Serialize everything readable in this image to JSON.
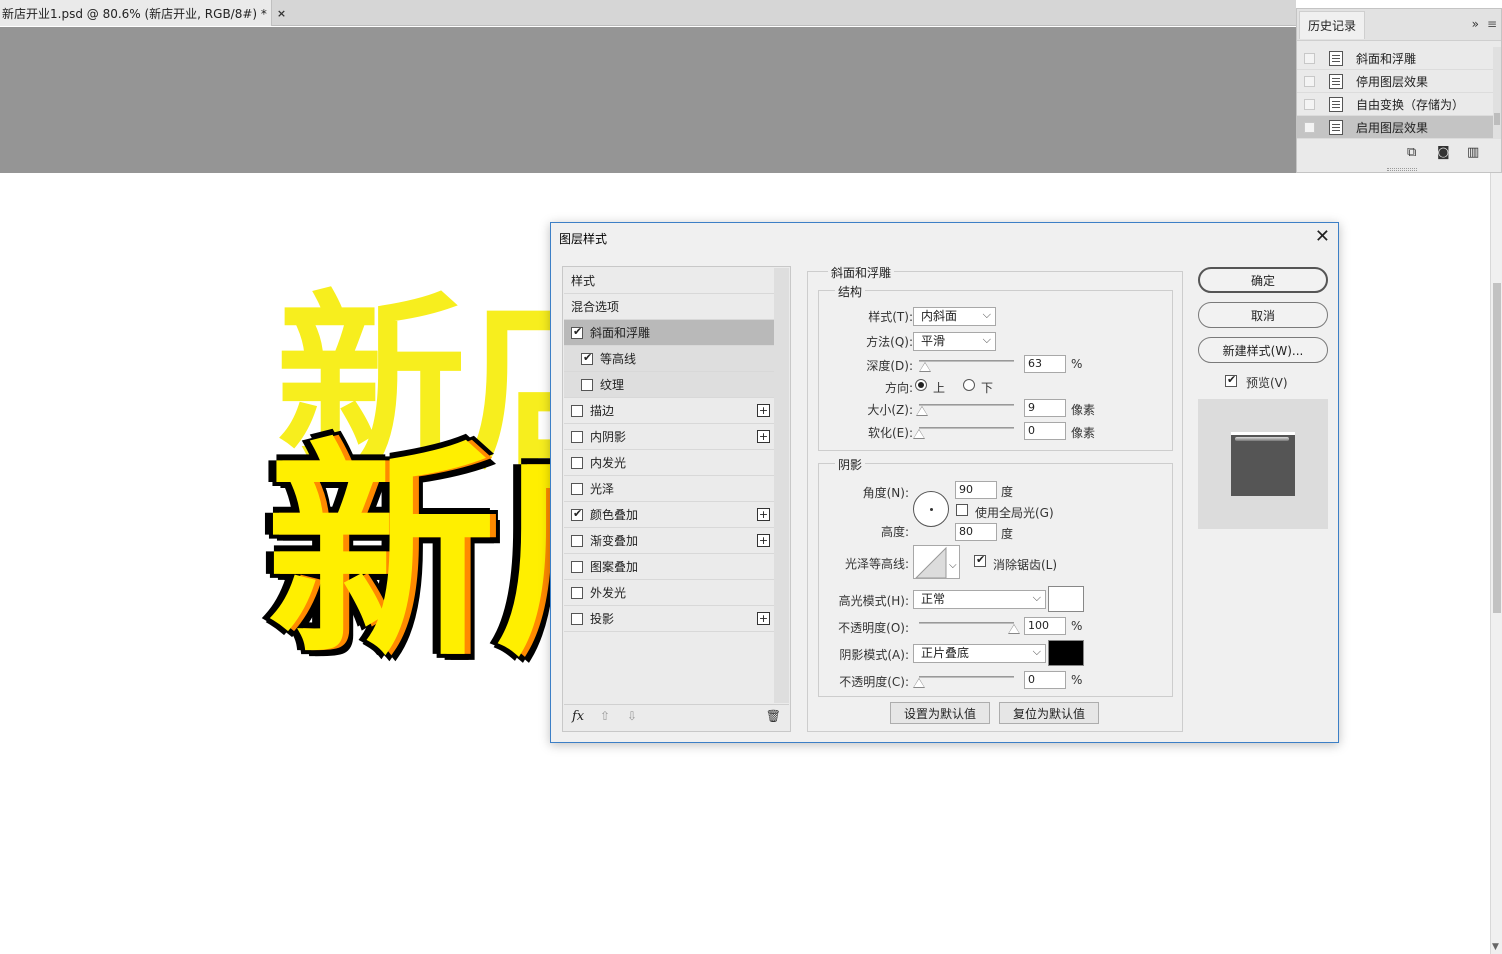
{
  "document": {
    "tab_title": "新店开业1.psd @ 80.6% (新店开业, RGB/8#) *",
    "close_glyph": "×",
    "art_text_back": "新店",
    "art_text_front": "新店"
  },
  "history_panel": {
    "tab": "历史记录",
    "expand_glyph": "»",
    "menu_glyph": "≡",
    "items": [
      {
        "label": "斜面和浮雕",
        "active": false
      },
      {
        "label": "停用图层效果",
        "active": false
      },
      {
        "label": "自由变换（存储为）",
        "active": false
      },
      {
        "label": "启用图层效果",
        "active": true
      }
    ],
    "footer_icons": [
      "new-document-icon",
      "camera-icon",
      "trash-icon"
    ]
  },
  "dialog": {
    "title": "图层样式",
    "close_glyph": "✕",
    "style_list": {
      "header": "样式",
      "blend_options": "混合选项",
      "items": [
        {
          "label": "斜面和浮雕",
          "checked": true,
          "selected": true,
          "sub": false,
          "plus": false
        },
        {
          "label": "等高线",
          "checked": true,
          "selected": false,
          "sub": true,
          "plus": false
        },
        {
          "label": "纹理",
          "checked": false,
          "selected": false,
          "sub": true,
          "plus": false
        },
        {
          "label": "描边",
          "checked": false,
          "selected": false,
          "sub": false,
          "plus": true
        },
        {
          "label": "内阴影",
          "checked": false,
          "selected": false,
          "sub": false,
          "plus": true
        },
        {
          "label": "内发光",
          "checked": false,
          "selected": false,
          "sub": false,
          "plus": false
        },
        {
          "label": "光泽",
          "checked": false,
          "selected": false,
          "sub": false,
          "plus": false
        },
        {
          "label": "颜色叠加",
          "checked": true,
          "selected": false,
          "sub": false,
          "plus": true
        },
        {
          "label": "渐变叠加",
          "checked": false,
          "selected": false,
          "sub": false,
          "plus": true
        },
        {
          "label": "图案叠加",
          "checked": false,
          "selected": false,
          "sub": false,
          "plus": false
        },
        {
          "label": "外发光",
          "checked": false,
          "selected": false,
          "sub": false,
          "plus": false
        },
        {
          "label": "投影",
          "checked": false,
          "selected": false,
          "sub": false,
          "plus": true
        }
      ],
      "footer": {
        "fx": "fx",
        "up": "⇧",
        "down": "⇩",
        "trash": "🗑"
      }
    },
    "bevel": {
      "title": "斜面和浮雕",
      "structure": {
        "title": "结构",
        "style_label": "样式(T):",
        "style_value": "内斜面",
        "technique_label": "方法(Q):",
        "technique_value": "平滑",
        "depth_label": "深度(D):",
        "depth_value": "63",
        "depth_unit": "%",
        "depth_fraction": 0.063,
        "direction_label": "方向:",
        "direction_up": "上",
        "direction_down": "下",
        "direction_selected": "上",
        "size_label": "大小(Z):",
        "size_value": "9",
        "size_unit": "像素",
        "size_fraction": 0.036,
        "soften_label": "软化(E):",
        "soften_value": "0",
        "soften_unit": "像素",
        "soften_fraction": 0
      },
      "shading": {
        "title": "阴影",
        "angle_label": "角度(N):",
        "angle_value": "90",
        "angle_unit": "度",
        "global_light_label": "使用全局光(G)",
        "global_light_checked": false,
        "altitude_label": "高度:",
        "altitude_value": "80",
        "altitude_unit": "度",
        "gloss_contour_label": "光泽等高线:",
        "antialias_label": "消除锯齿(L)",
        "antialias_checked": true,
        "highlight_mode_label": "高光模式(H):",
        "highlight_mode_value": "正常",
        "highlight_color": "#ffffff",
        "highlight_opacity_label": "不透明度(O):",
        "highlight_opacity_value": "100",
        "highlight_opacity_unit": "%",
        "highlight_opacity_fraction": 1.0,
        "shadow_mode_label": "阴影模式(A):",
        "shadow_mode_value": "正片叠底",
        "shadow_color": "#000000",
        "shadow_opacity_label": "不透明度(C):",
        "shadow_opacity_value": "0",
        "shadow_opacity_unit": "%",
        "shadow_opacity_fraction": 0
      },
      "make_default": "设置为默认值",
      "reset_default": "复位为默认值"
    },
    "buttons": {
      "ok": "确定",
      "cancel": "取消",
      "new_style": "新建样式(W)...",
      "preview_label": "预览(V)",
      "preview_checked": true
    }
  }
}
